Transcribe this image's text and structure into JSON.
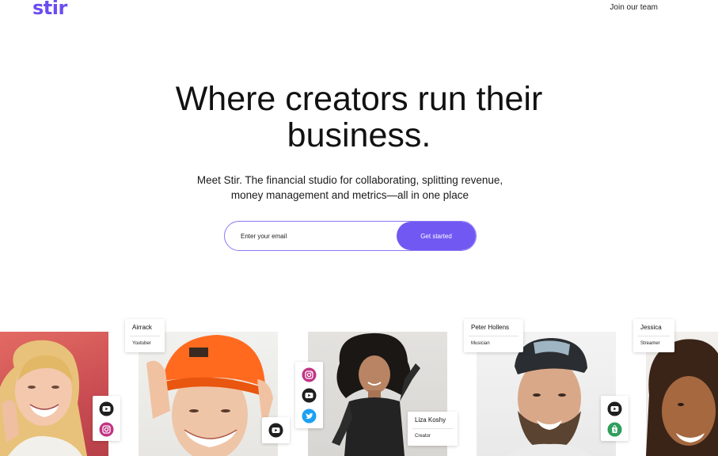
{
  "header": {
    "logo_text": "stir",
    "nav_link": "Join our team"
  },
  "hero": {
    "title_line1": "Where creators run their",
    "title_line2": "business.",
    "subtitle_line1": "Meet Stir. The financial studio for collaborating, splitting revenue,",
    "subtitle_line2": "money management and metrics—all in one place"
  },
  "signup": {
    "email_placeholder": "Enter your email",
    "button_label": "Get started"
  },
  "creators": [
    {
      "name": "Airrack",
      "role": "Youtuber"
    },
    {
      "name": "Liza Koshy",
      "role": "Creator"
    },
    {
      "name": "Peter Hollens",
      "role": "Musician"
    },
    {
      "name": "Jessica",
      "role": "Streamer"
    }
  ],
  "icons": {
    "youtube": "youtube-icon",
    "instagram": "instagram-icon",
    "twitter": "twitter-icon",
    "shopify": "shopify-icon"
  },
  "colors": {
    "brand": "#6c4cf1",
    "button": "#7258f3",
    "instagram": "#c13584",
    "twitter": "#1da1f2",
    "shopify": "#2f9e5b"
  }
}
